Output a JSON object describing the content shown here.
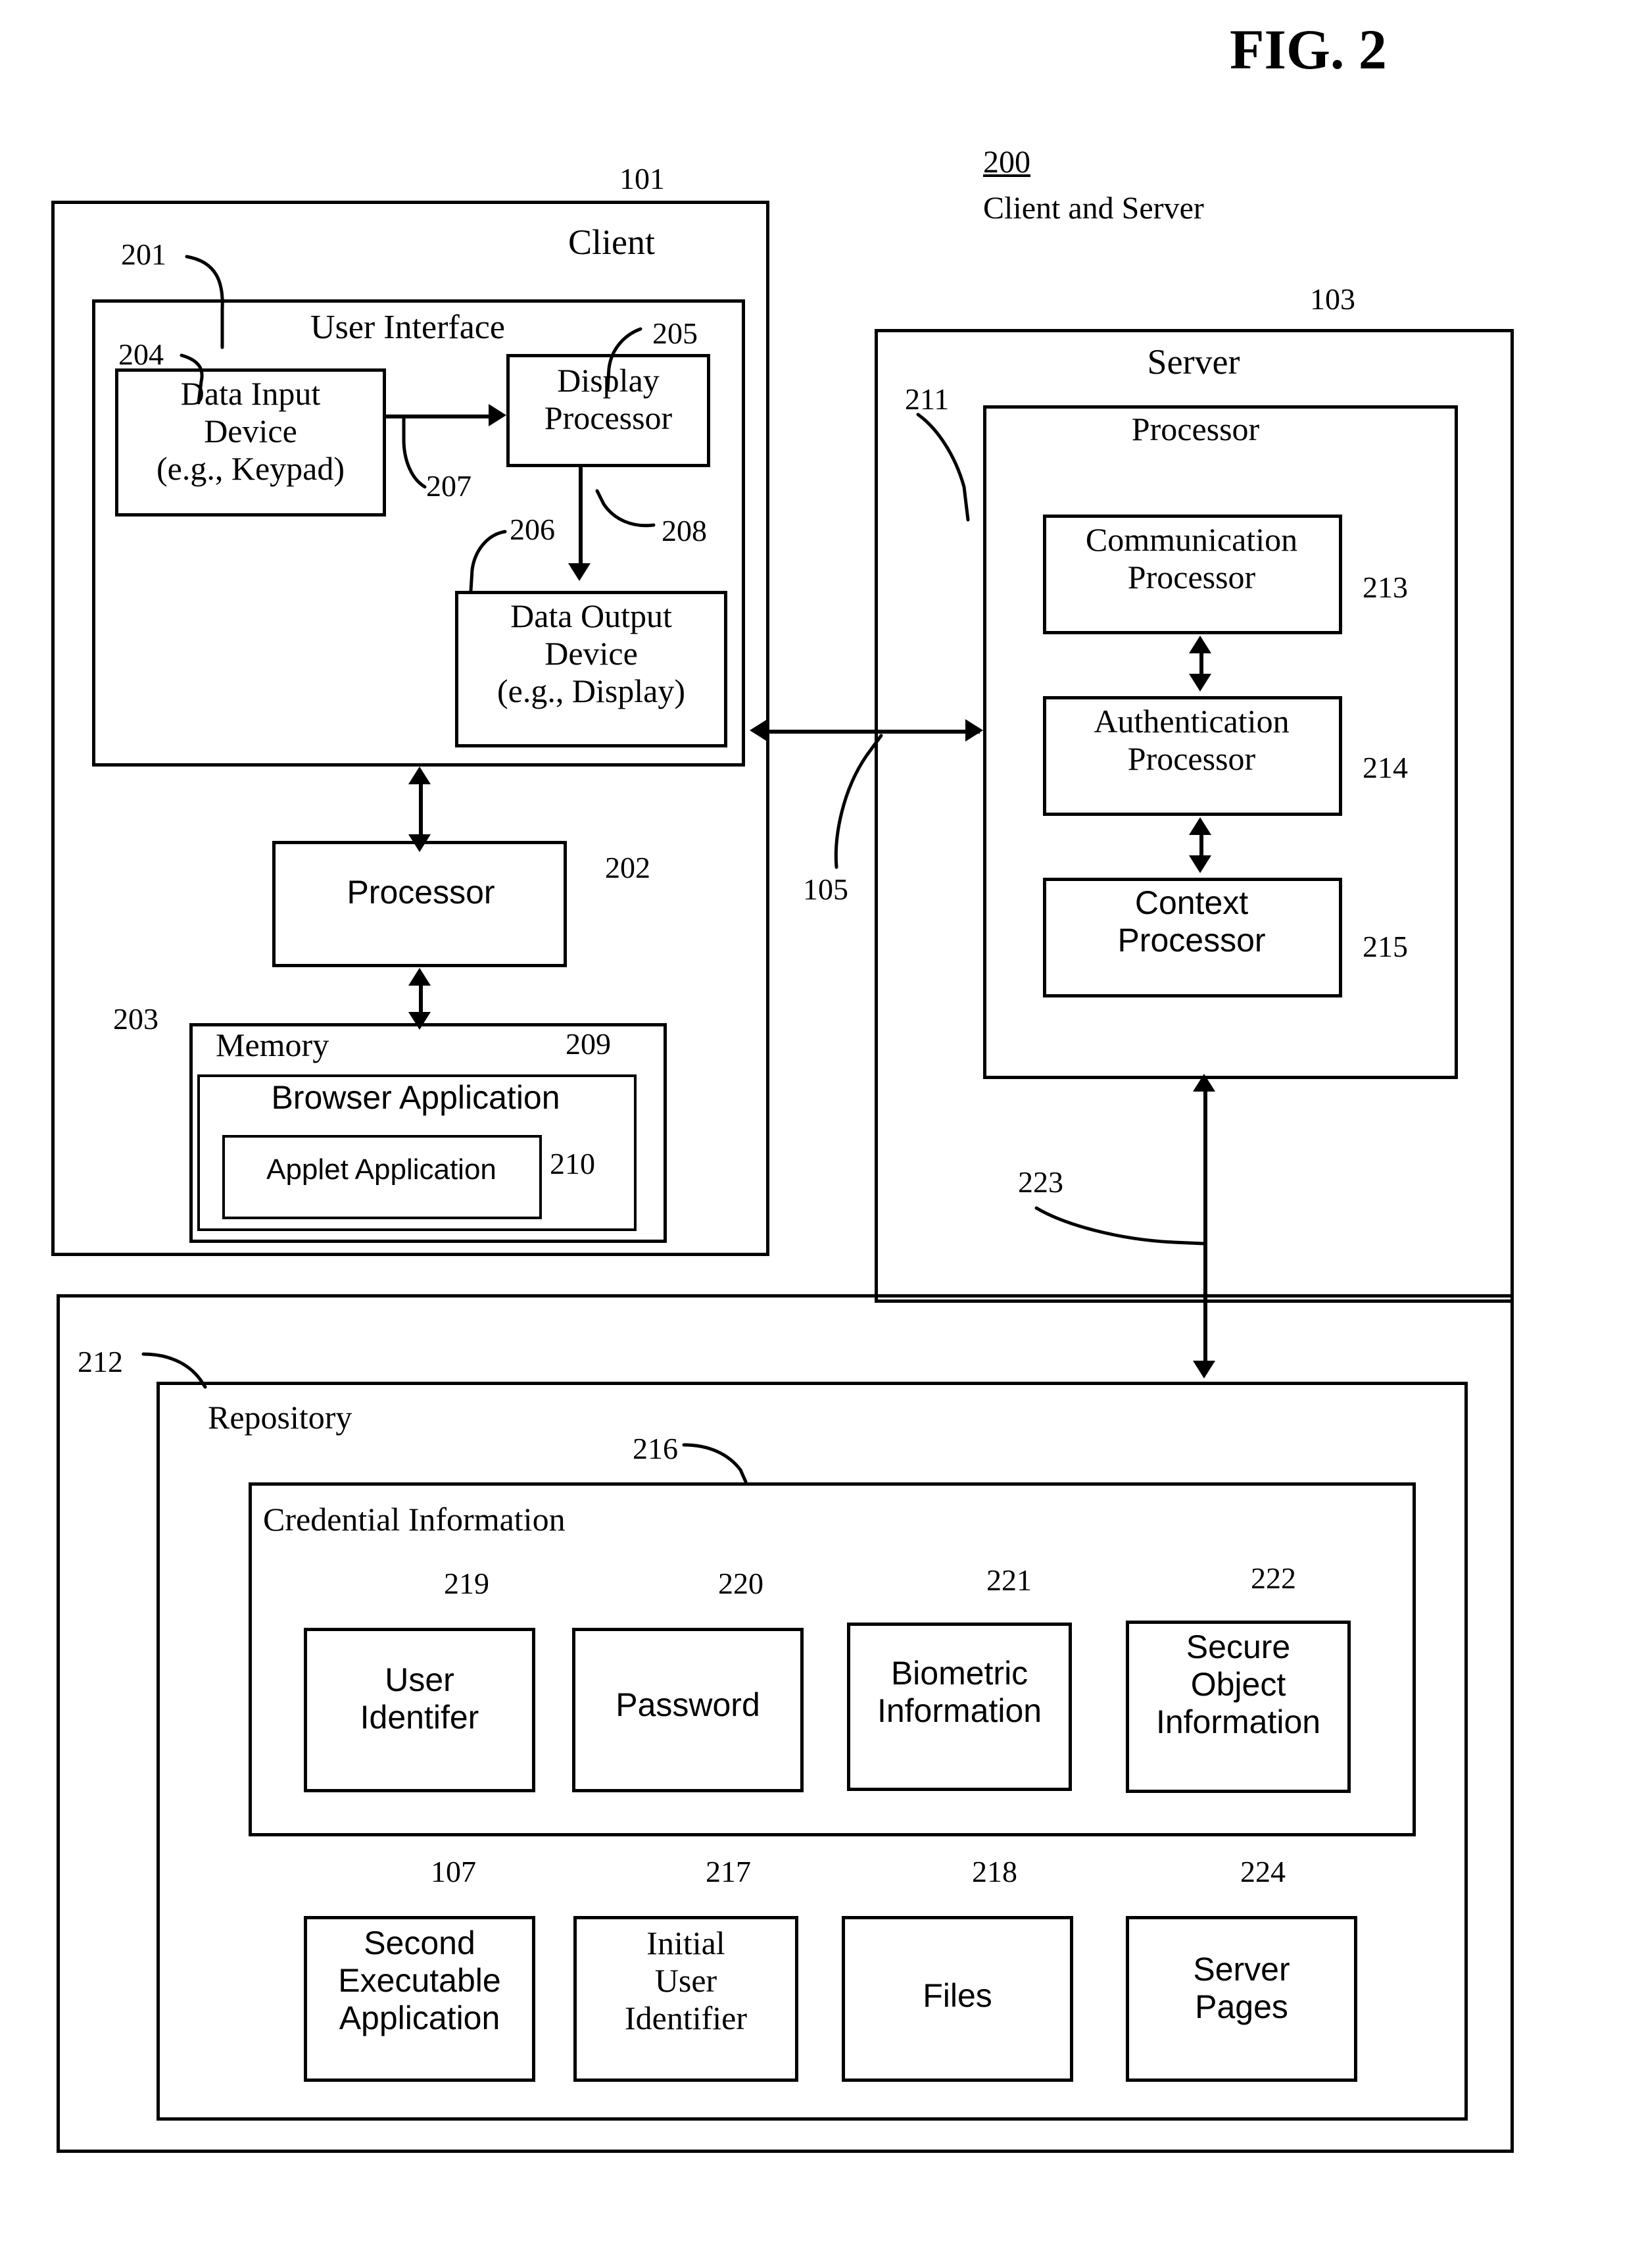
{
  "figure": {
    "title": "FIG. 2",
    "system_number": "200",
    "system_label": "Client and Server"
  },
  "client": {
    "ref": "101",
    "title": "Client",
    "user_interface": {
      "ref": "201",
      "title": "User Interface",
      "data_input_device": {
        "ref": "204",
        "lines": [
          "Data Input",
          "Device",
          "(e.g., Keypad)"
        ]
      },
      "display_processor": {
        "ref": "205",
        "lines": [
          "Display",
          "Processor"
        ]
      },
      "data_output_device": {
        "ref": "206",
        "lines": [
          "Data Output",
          "Device",
          "(e.g., Display)"
        ]
      },
      "link_input_to_display": "207",
      "link_display_to_output": "208"
    },
    "processor": {
      "ref": "202",
      "label": "Processor"
    },
    "memory": {
      "ref": "203",
      "label": "Memory",
      "browser_application": {
        "ref": "209",
        "label": "Browser Application"
      },
      "applet_application": {
        "ref": "210",
        "label": "Applet Application"
      }
    }
  },
  "network": {
    "ref": "105"
  },
  "server": {
    "ref": "103",
    "title": "Server",
    "processor": {
      "ref": "211",
      "label": "Processor",
      "communication_processor": {
        "ref": "213",
        "lines": [
          "Communication",
          "Processor"
        ]
      },
      "authentication_processor": {
        "ref": "214",
        "lines": [
          "Authentication",
          "Processor"
        ]
      },
      "context_processor": {
        "ref": "215",
        "lines": [
          "Context",
          "Processor"
        ]
      }
    },
    "repository_link": "223"
  },
  "repository": {
    "ref": "212",
    "title": "Repository",
    "credential_information": {
      "ref": "216",
      "title": "Credential Information",
      "items": [
        {
          "ref": "219",
          "lines": [
            "User",
            "Identifer"
          ]
        },
        {
          "ref": "220",
          "lines": [
            "Password"
          ]
        },
        {
          "ref": "221",
          "lines": [
            "Biometric",
            "Information"
          ]
        },
        {
          "ref": "222",
          "lines": [
            "Secure",
            "Object",
            "Information"
          ]
        }
      ]
    },
    "items": [
      {
        "ref": "107",
        "lines": [
          "Second",
          "Executable",
          "Application"
        ]
      },
      {
        "ref": "217",
        "lines": [
          "Initial",
          "User",
          "Identifier"
        ]
      },
      {
        "ref": "218",
        "lines": [
          "Files"
        ]
      },
      {
        "ref": "224",
        "lines": [
          "Server",
          "Pages"
        ]
      }
    ]
  },
  "colors": {
    "ink": "#000000",
    "paper": "#ffffff"
  }
}
